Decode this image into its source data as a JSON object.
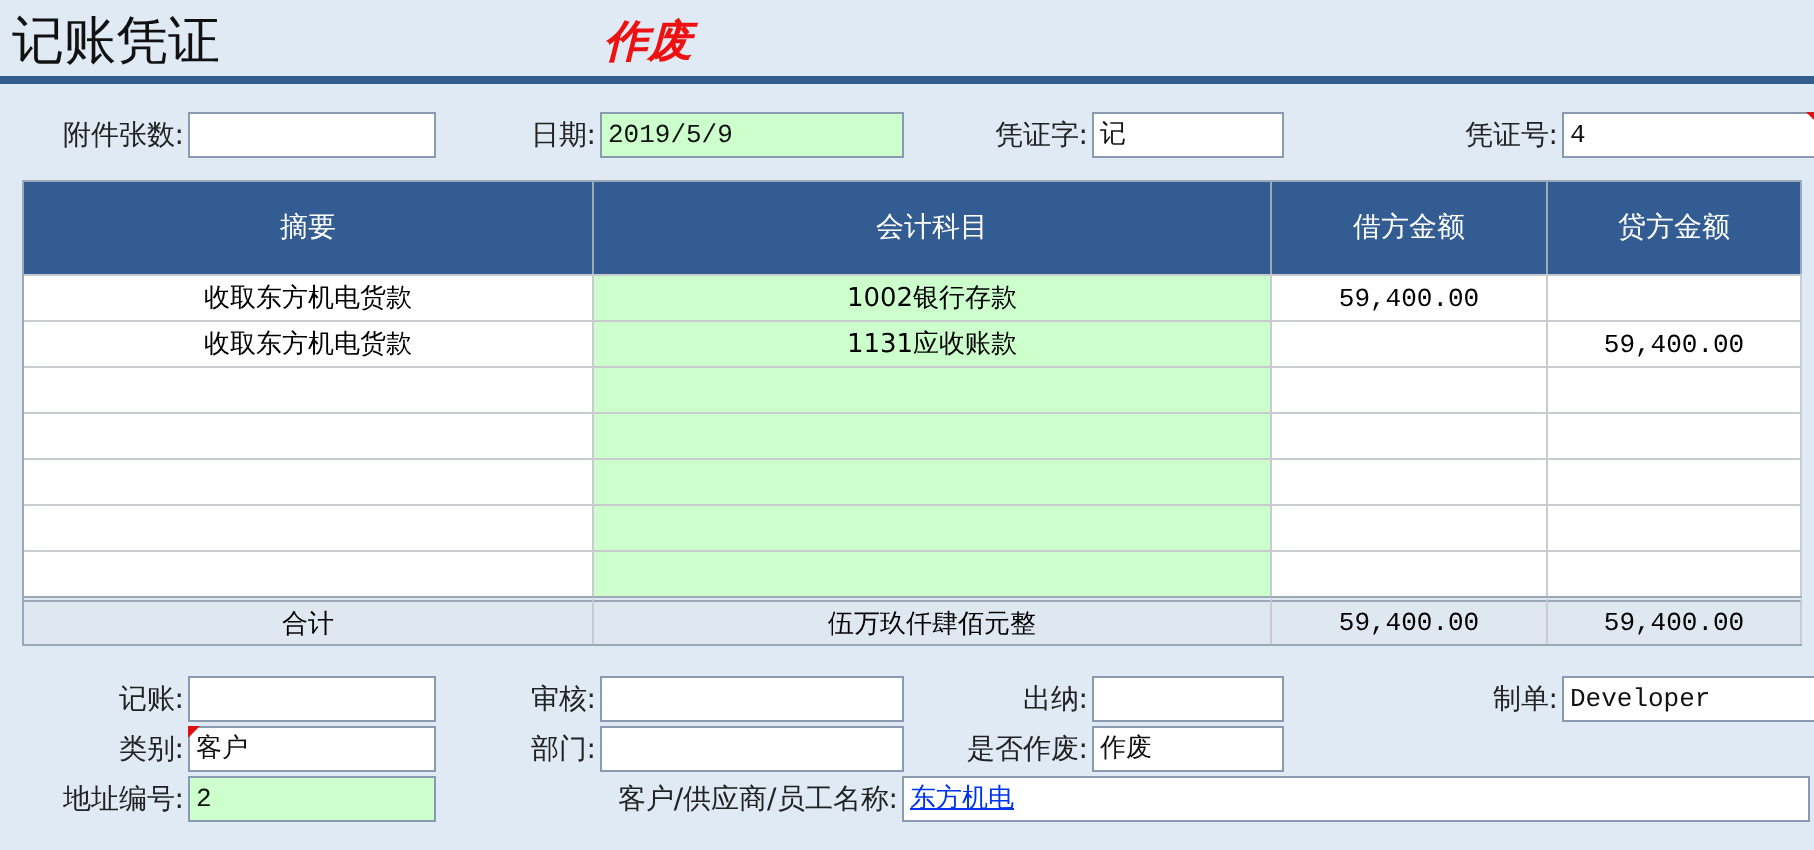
{
  "title": "记账凭证",
  "stamp": "作废",
  "top_fields": [
    {
      "label": "附件张数:",
      "highlighted": false,
      "flagged": false
    },
    {
      "label": "日期:",
      "value": "2019/5/9",
      "highlighted": true,
      "flagged": false
    },
    {
      "label": "凭证字:",
      "value": "记",
      "highlighted": false,
      "flagged": false
    },
    {
      "label": "凭证号:",
      "value": "4",
      "highlighted": false,
      "flagged": true
    }
  ],
  "table": {
    "columns": [
      "摘要",
      "会计科目",
      "借方金额",
      "贷方金额"
    ],
    "rows": [
      [
        "收取东方机电货款",
        "1002银行存款",
        "59,400.00",
        ""
      ],
      [
        "收取东方机电货款",
        "1131应收账款",
        "",
        "59,400.00"
      ]
    ],
    "total": [
      "合计",
      "伍万玖仟肆佰元整",
      "59,400.00",
      "59,400.00"
    ]
  },
  "bottom_fields": [
    [
      {
        "label": "记账:",
        "highlighted": false,
        "flagged": false
      },
      {
        "label": "审核:",
        "highlighted": false,
        "flagged": false
      },
      {
        "label": "出纳:",
        "highlighted": false,
        "flagged": false
      },
      {
        "label": "制单:",
        "value": "Developer",
        "highlighted": false,
        "flagged": false
      }
    ],
    [
      {
        "label": "类别:",
        "value": "客户",
        "highlighted": false,
        "flagged": true
      },
      {
        "label": "部门:",
        "highlighted": false,
        "flagged": false
      },
      {
        "label": "是否作废:",
        "value": "作废",
        "highlighted": false,
        "flagged": false
      }
    ],
    [
      {
        "label": "地址编号:",
        "value": "2",
        "highlighted": true,
        "flagged": false
      },
      {
        "label": "客户/供应商/员工名称:",
        "value": "东方机电",
        "highlighted": false,
        "flagged": false,
        "kind": "link"
      }
    ]
  ]
}
